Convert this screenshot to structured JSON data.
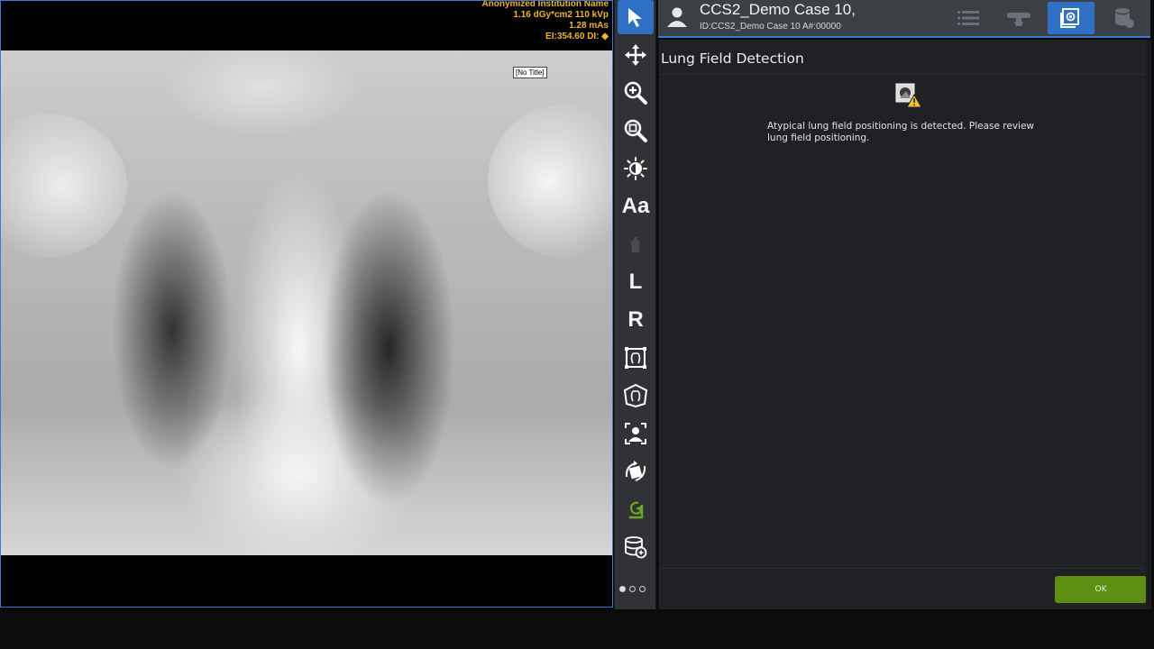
{
  "image": {
    "overlay_lines": [
      "Anonymized Institution Name",
      "1.16 dGy*cm2  110 kVp",
      "1.28 mAs",
      "EI:354.60 DI:  ◆"
    ],
    "no_title_label": "[No Title]"
  },
  "toolbar": {
    "items": [
      {
        "name": "select-pointer-icon",
        "active": true
      },
      {
        "name": "pan-move-icon"
      },
      {
        "name": "zoom-in-icon"
      },
      {
        "name": "zoom-fit-icon"
      },
      {
        "name": "brightness-contrast-icon"
      },
      {
        "name": "annotation-text-tool",
        "label": "Aa"
      },
      {
        "name": "disabled-tool-icon"
      },
      {
        "name": "marker-left",
        "label": "L"
      },
      {
        "name": "marker-right",
        "label": "R"
      },
      {
        "name": "crop-collimation-icon"
      },
      {
        "name": "shutter-icon"
      },
      {
        "name": "patient-position-icon"
      },
      {
        "name": "rotate-flip-icon"
      },
      {
        "name": "reprocess-icon"
      },
      {
        "name": "image-database-icon"
      }
    ],
    "pages": 3,
    "current_page": 0
  },
  "header": {
    "patient_name": "CCS2_Demo Case 10,",
    "patient_id": "ID:CCS2_Demo Case 10    A#:00000",
    "buttons": [
      "worklist-icon",
      "tube-icon",
      "image-review-icon",
      "archive-icon"
    ],
    "active_button": "image-review-icon"
  },
  "panel": {
    "title": "Lung Field Detection",
    "message": "Atypical lung field positioning is detected. Please review lung field positioning.",
    "ok_label": "OK"
  },
  "colors": {
    "accent": "#2f6fc4",
    "ok": "#5d8f12",
    "overlay_text": "#f2b52b",
    "warning": "#f2c12e"
  }
}
